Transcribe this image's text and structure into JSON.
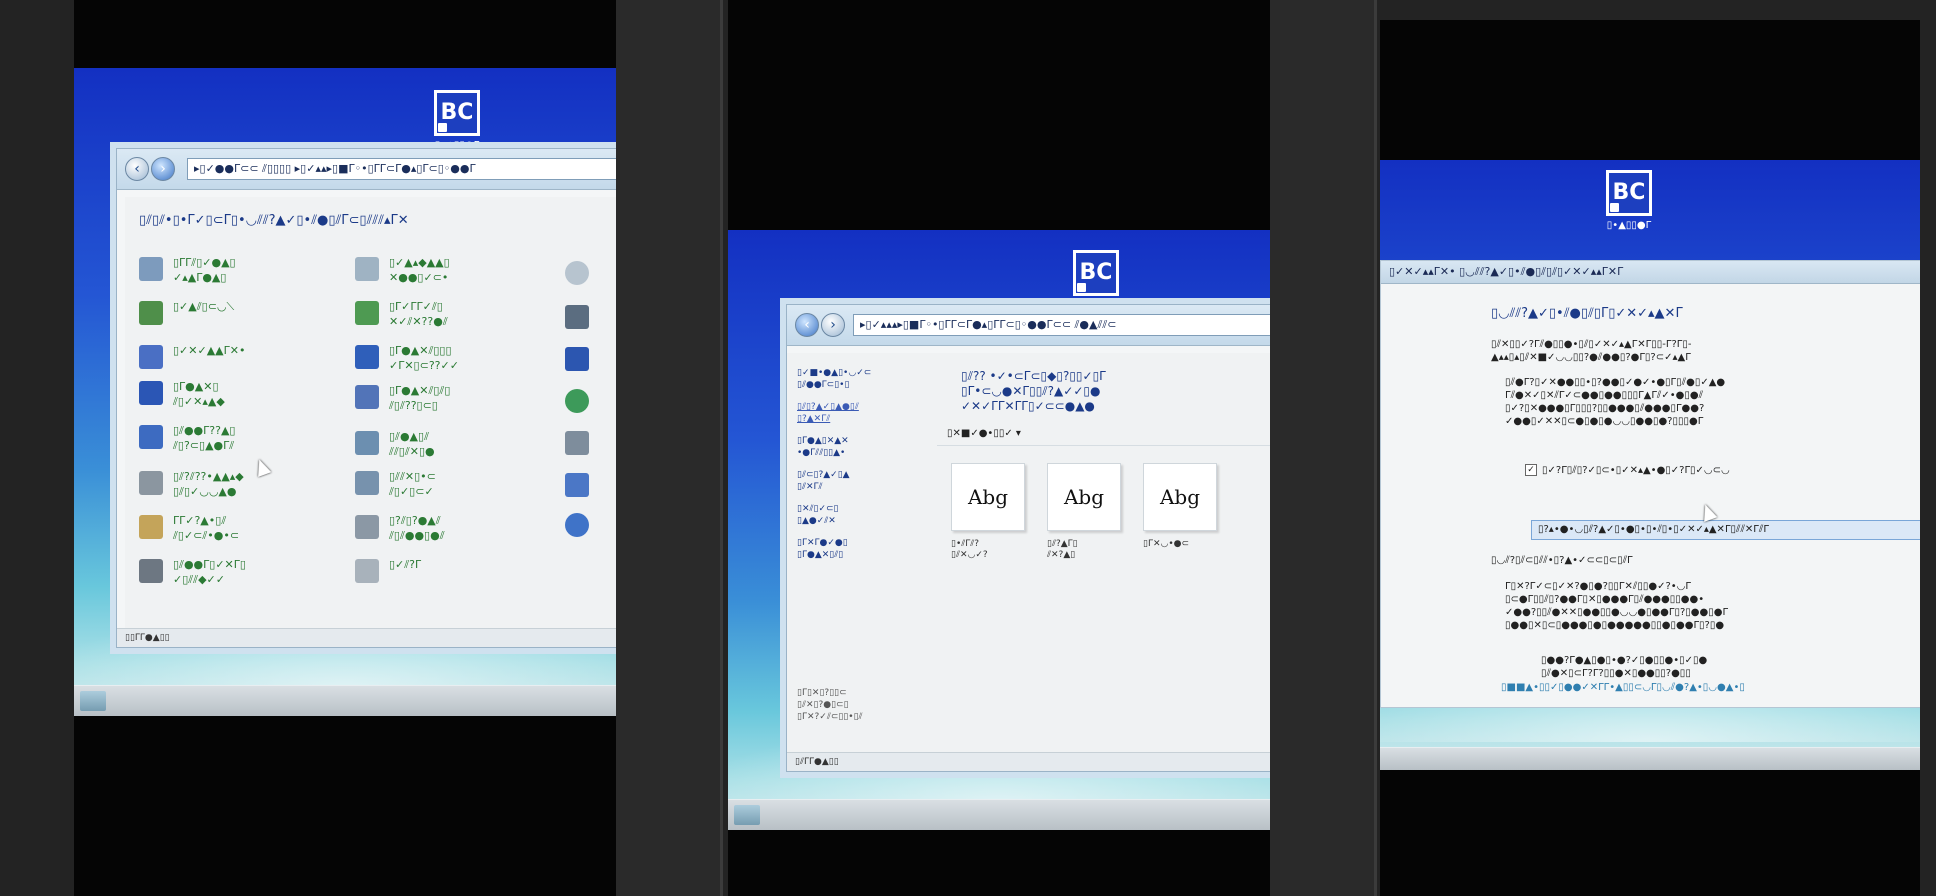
{
  "logo": {
    "text": "BC",
    "caption": "▯•▲▯▯●Γ"
  },
  "panel1": {
    "address": "▸▯✓●●Γ⊂⊂ ⫽▯▯▯▯ ▸▯✓▴▴▸▯■Γ◦•▯ΓΓ⊂Γ●▴▯Γ⊂▯◦●●Γ",
    "heading": "▯⫽▯⫽•▯•Γ✓▯⊂Γ▯•◡⫽⫽?▲✓▯•⫽●▯⫽Γ⊂▯⫽⫽⫽▴Γ✕",
    "items": [
      {
        "label": "▯ΓΓ⫽▯✓●▲▯\n✓▴▲Γ●▲▯"
      },
      {
        "label": "▯✓▲⫽▯⊂◡⟍"
      },
      {
        "label": "▯✓✕✓▲▲Γ✕•"
      },
      {
        "label": "▯Γ●▲✕▯\n⫽▯✓✕▴▲◆"
      },
      {
        "label": "▯⫽●●Γ??▲▯\n⫽▯?⊂▯▲●Γ⫽"
      },
      {
        "label": "▯⫽?⫽??•▲▲▴◆\n▯⫽▯✓◡◡▲●"
      },
      {
        "label": "ΓΓ✓?▲•▯⫽\n⫽▯✓⊂⫽•●•⊂"
      },
      {
        "label": "▯⫽●●Γ▯✓✕Γ▯\n✓▯⫽⫽◆✓✓"
      },
      {
        "label": "▯✓▲▴◆▲▲▯\n✕●●▯✓⊂•"
      },
      {
        "label": "▯Γ✓ΓΓ✓⫽▯\n✕✓⫽✕??●⫽"
      },
      {
        "label": "▯Γ●▲✕⫽▯▯▯\n✓Γ✕▯⊂??✓✓"
      },
      {
        "label": "▯Γ●▲✕⫽▯⫽▯\n⫽▯⫽??▯⊂▯"
      },
      {
        "label": "▯⫽●▲▯⫽\n⫽⫽▯⫽✕▯●"
      },
      {
        "label": "▯⫽⫽✕▯•⊂\n⫽▯✓▯⊂✓"
      },
      {
        "label": "▯?⫽▯?●▲⫽\n⫽▯⫽●●▯●⫽"
      },
      {
        "label": "▯✓⫽?Γ"
      }
    ],
    "status": "▯▯ΓΓ●▲▯▯"
  },
  "panel2": {
    "address": "▸▯✓▴▴▴▸▯■Γ◦•▯ΓΓ⊂Γ●▴▯ΓΓ⊂▯◦●●Γ⊂⊂ ⫽●▲⫽⫽⊂",
    "sidebar": [
      "▯✓■•●▲▯•◡✓⊂\n▯⫽●●Γ⊂▯•▯",
      "▯⫽▯?▲✓▯▲●▯⫽\n▯?▲✕Γ⫽",
      "▯Γ●▲▯✕▲✕\n•●Γ⫽⫽▯▯▲•",
      "▯⫽⊂▯?▲✓▯▲\n▯⫽✕Γ⫽",
      "▯✕⫽▯✓⊂▯\n▯▲●✓⫽✕",
      "▯Γ✕Γ●✓●▯\n▯Γ●▲✕▯⫽▯"
    ],
    "title": "▯⫽?? •✓•⊂Γ⊂▯◆▯?▯▯✓▯Γ\n▯Γ•⊂◡●✕Γ▯▯⫽?▲✓✓▯●\n✓✕✓ΓΓ✕ΓΓ▯✓⊂⊂●▲●",
    "toolbar": "▯✕■✓●•▯▯✓ ▾",
    "cards": [
      {
        "sample": "Abg",
        "name": "▯•⫽Γ⫽?\n▯⫽✕◡✓?"
      },
      {
        "sample": "Abg",
        "name": "▯⫽?▲Γ▯\n⫽✕?▲▯"
      },
      {
        "sample": "Abg",
        "name": "▯Γ✕◡•●⊂"
      }
    ],
    "see_also": "▯Γ▯✕▯?▯▯⊂\n▯⫽✕▯?●▯⊂▯\n▯Γ✕?✓⫽⊂▯▯•▯⫽",
    "status": "▯⫽ΓΓ●▲▯▯"
  },
  "panel3": {
    "titlebar": "▯✓✕✓▴▴Γ✕• ▯◡⫽⫽?▲✓▯•⫽●▯⫽▯⫽▯✓✕✓▴▴Γ✕Γ",
    "heading": "▯◡⫽⫽?▲✓▯•⫽●▯⫽▯Γ▯✓✕✓▴▲✕Γ",
    "para1": "▯⫽✕▯▯✓?Γ⫽●▯▯●•▯⫽▯✓✕✓▴▲Γ✕Γ▯▯-Γ?Γ▯-\n▲▴▴▯▴▯⫽✕■✓◡◡▯▯?●⫽●●▯?●Γ▯?⊂✓▴▲Γ",
    "para2": "▯⫽●Γ?▯✓✕●●▯▯•▯?●●▯✓●✓•●▯Γ▯⫽●▯✓▲●\nΓ⫽●✕✓▯✕⫽Γ✓⊂●●▯●●▯▯▯Γ▲Γ⫽✓•●▯●⫽\n▯✓?▯✕●●●▯Γ▯▯▯?▯▯●●●▯⫽●●●▯Γ●●?\n✓●●▯✓✕✕▯⊂●▯●▯●◡◡▯●●▯●?▯▯▯●Γ",
    "check_label": "▯✓?Γ▯⫽▯?✓▯⊂•▯✓✕▴▲•●▯✓?Γ▯✓◡⊂◡",
    "selected": "▯?▴•●•◡▯⫽?▲✓▯•●▯•▯•⫽▯•▯✓✕✓▴▲✕Γ▯⫽⫽✕Γ⫽Γ",
    "section2": "▯◡⫽?▯⫽⊂▯⫽⫽•▯?▲•✓⊂⊂▯⊂▯⫽Γ",
    "para3": "Γ▯✕?Γ✓⊂▯✓✕?●▯●?▯▯Γ✕⫽▯▯●✓?•◡Γ\n▯⊂●Γ▯▯⫽▯?●●Γ▯✕▯●●●Γ▯⫽●●●▯▯●●•\n✓●●?▯▯⫽●✕✕▯●●▯▯●◡◡●▯●●Γ▯?▯●●▯●Γ\n▯●●▯✕▯⊂▯●●●▯●▯●●●●●▯▯●▯●●Γ▯?▯●",
    "para4": "▯●●?Γ●▲▯●▯•●?✓▯●▯▯●•▯✓▯●\n▯⫽●✕▯⊂Γ?Γ?▯▯●✕▯●●▯▯?●▯▯",
    "link": "▯■■▲•▯▯✓▯●●✓✕ΓΓ•▲▯▯⊂◡Γ▯◡⫽●?▲•▯◡●▲•▯"
  }
}
